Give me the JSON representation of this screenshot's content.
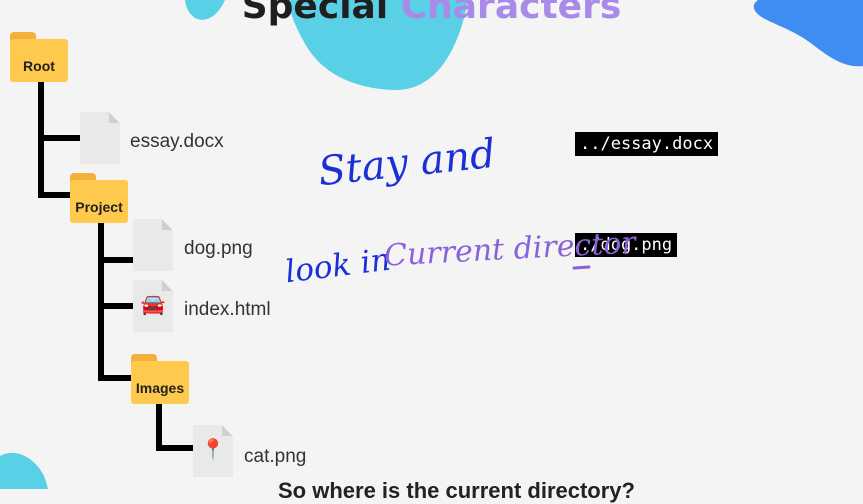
{
  "slide": {
    "title_main": "Special",
    "title_accent": "Characters",
    "caption": "So where is the current directory?"
  },
  "tree": {
    "root": "Root",
    "essay": "essay.docx",
    "project": "Project",
    "dog": "dog.png",
    "index": "index.html",
    "images": "Images",
    "cat": "cat.png"
  },
  "paths": {
    "parent_example": "../essay.docx",
    "current_example": "./dog.png"
  },
  "annotations": {
    "line1": "Stay and",
    "line2a": "look in",
    "line2b": "Current director"
  },
  "icons": {
    "index_glyph": "🚘",
    "cat_glyph": "📍"
  },
  "colors": {
    "folder": "#ffc94d",
    "accent_purple": "#a98ae8",
    "ink_blue": "#1b2fd6",
    "ink_purple": "#8a62d8",
    "blob_cyan": "#5ad0e6",
    "blob_blue": "#3f8df0"
  }
}
